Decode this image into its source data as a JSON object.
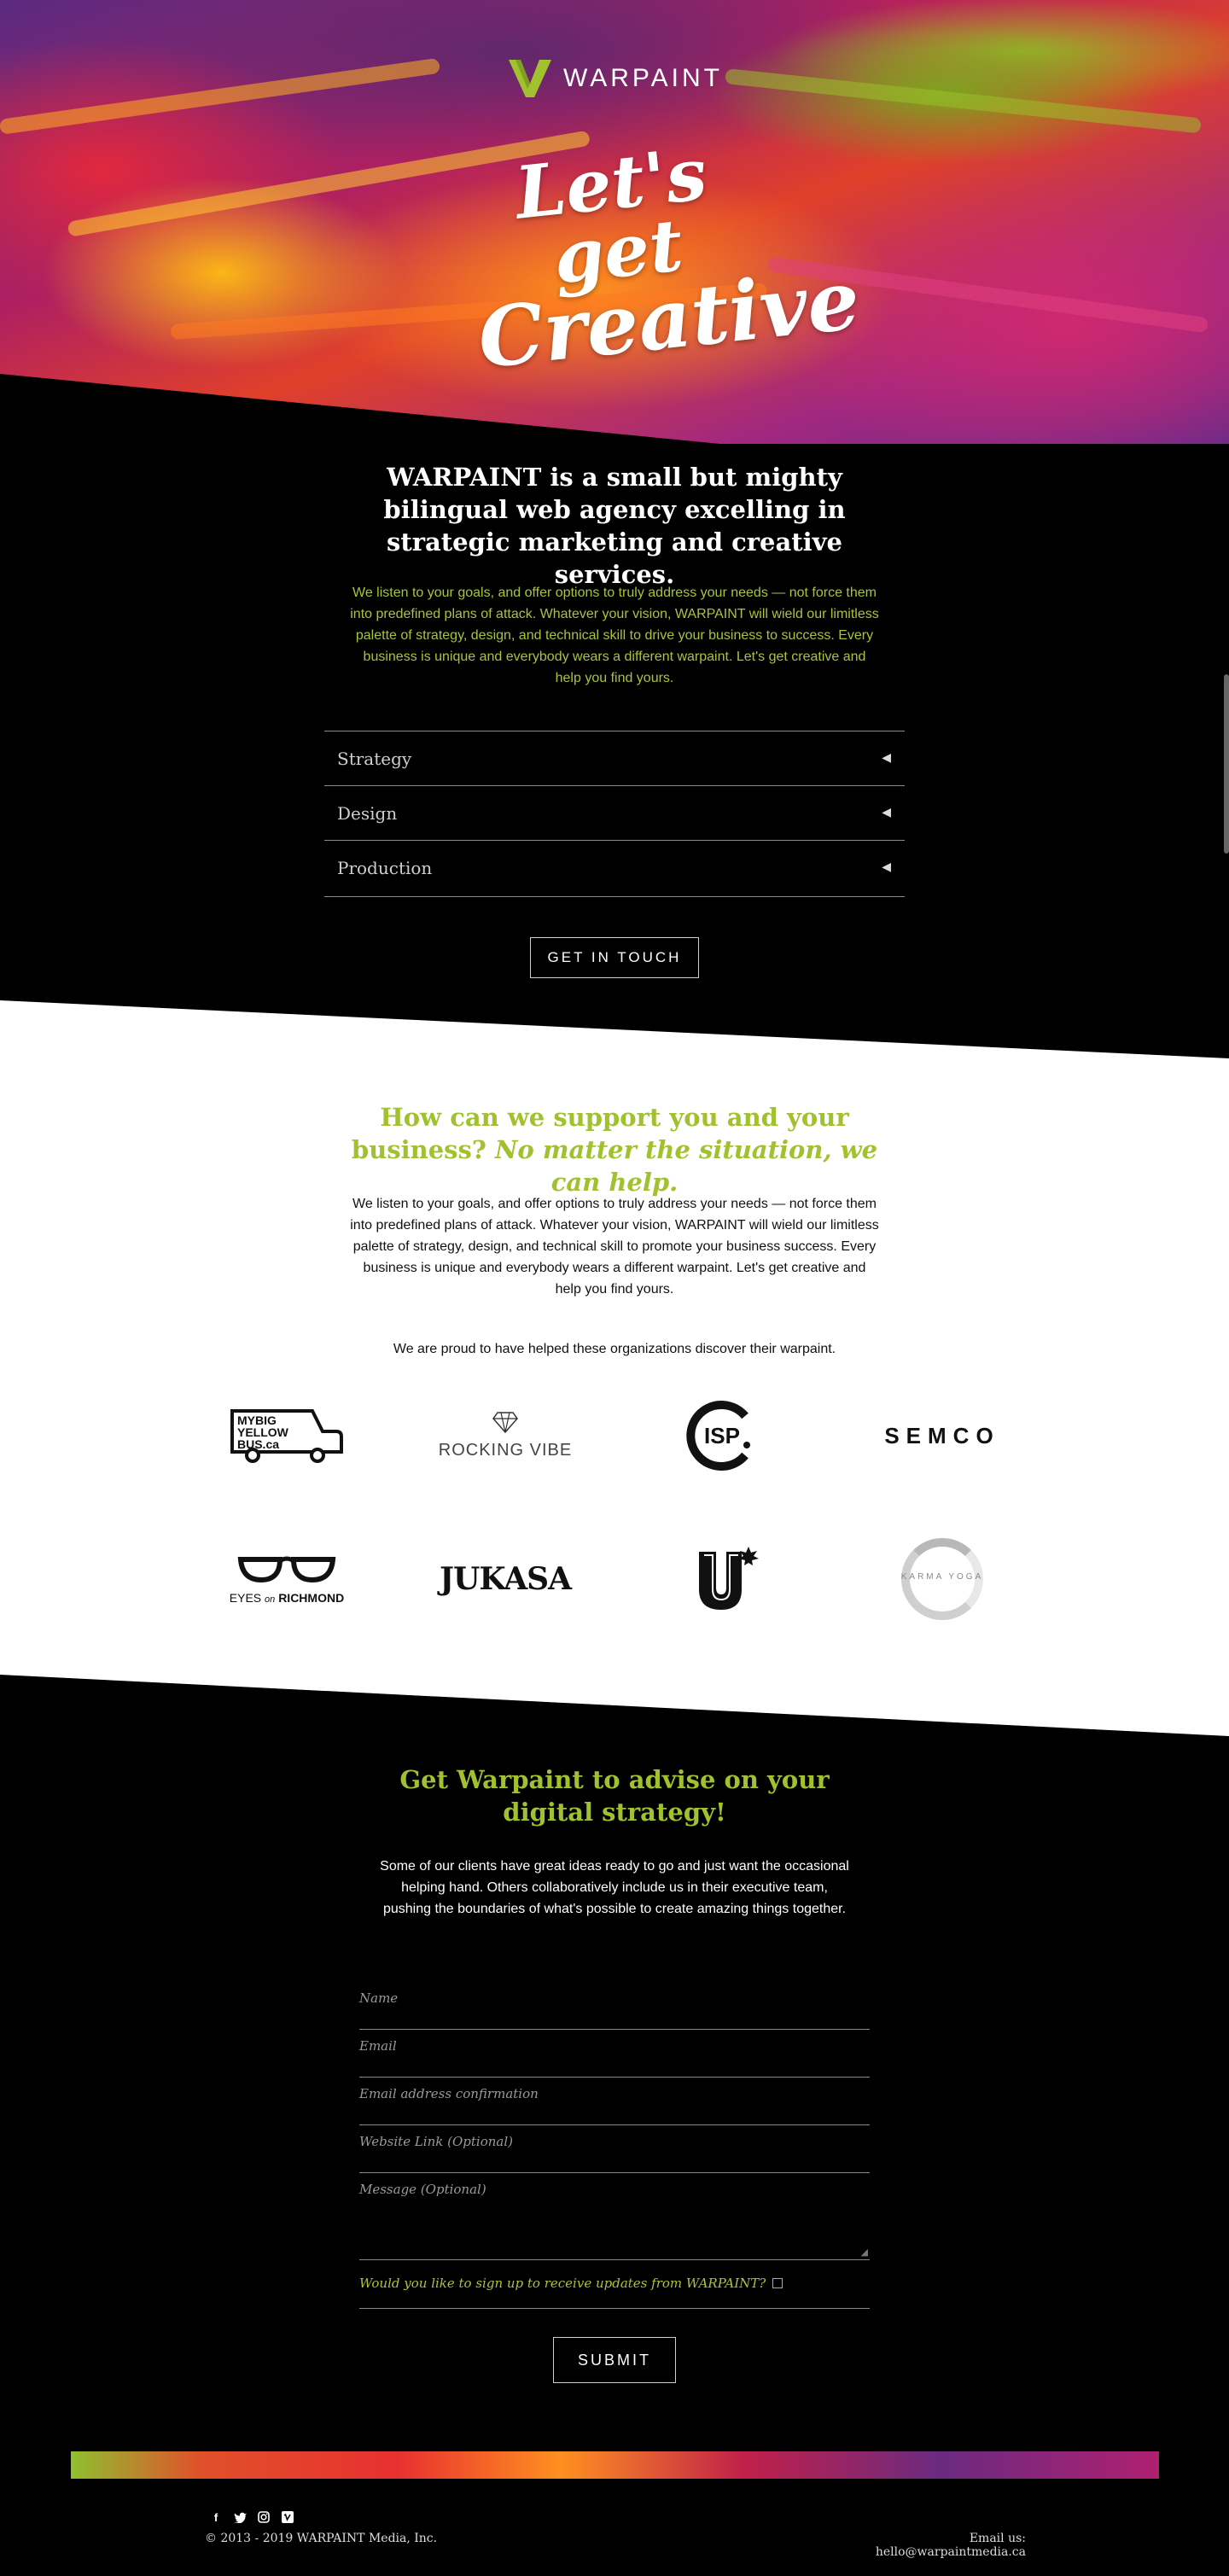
{
  "brand": {
    "name": "WARPAINT",
    "accent": "#a2c12f"
  },
  "hero": {
    "script_line1": "Let's get",
    "script_line2": "Creative"
  },
  "intro": {
    "title": "WARPAINT is a small but mighty bilingual web agency excelling in strategic marketing and creative services.",
    "body": "We listen to your goals, and offer options to truly address your needs — not force them into predefined plans of attack. Whatever your vision, WARPAINT will wield our limitless palette of strategy, design, and technical skill to drive your business to success. Every business is unique and everybody wears a different warpaint. Let's get creative and help you find yours.",
    "accordion": [
      {
        "label": "Strategy",
        "icon": "triangle-left-icon"
      },
      {
        "label": "Design",
        "icon": "triangle-left-icon"
      },
      {
        "label": "Production",
        "icon": "triangle-left-icon"
      }
    ],
    "cta": "GET IN TOUCH"
  },
  "support": {
    "title_plain": "How can we support you and your business?",
    "title_italic": "No matter the situation, we can help.",
    "body": "We listen to your goals, and offer options to truly address your needs — not force them into predefined plans of attack. Whatever your vision, WARPAINT will wield our limitless palette of strategy, design, and technical skill to promote your business success. Every business is unique and everybody wears a different warpaint. Let's get creative and help you find yours.",
    "proud": "We are proud to have helped these organizations discover their warpaint.",
    "clients": [
      {
        "name": "MYBIG YELLOW BUS.ca",
        "icon": "bus-logo"
      },
      {
        "name": "ROCKING VIBE",
        "icon": "diamond-logo"
      },
      {
        "name": "ISP",
        "icon": "isp-logo"
      },
      {
        "name": "SEMCO",
        "icon": "semco-logo"
      },
      {
        "name_a": "EYES",
        "name_b": "on",
        "name_c": "RICHMOND",
        "icon": "glasses-logo"
      },
      {
        "name": "JUKASA",
        "icon": "jukasa-logo"
      },
      {
        "name": "U",
        "icon": "u-maple-logo"
      },
      {
        "name": "KARMA YOGA",
        "icon": "karma-yoga-logo"
      }
    ]
  },
  "contact": {
    "title": "Get Warpaint to advise on your digital strategy!",
    "body": "Some of our clients have great ideas ready to go and just want the occasional helping hand. Others collaboratively include us in their executive team, pushing the boundaries of what's possible to create amazing things together.",
    "fields": {
      "name": "Name",
      "email": "Email",
      "email_confirm": "Email address confirmation",
      "website": "Website Link (Optional)",
      "message": "Message (Optional)"
    },
    "consent": "Would you like to sign up to receive updates from WARPAINT?",
    "submit": "SUBMIT"
  },
  "footer": {
    "social": [
      "facebook-icon",
      "twitter-icon",
      "instagram-icon",
      "vimeo-icon"
    ],
    "copyright": "© 2013 - 2019 WARPAINT Media, Inc.",
    "email": "Email us: hello@warpaintmedia.ca"
  }
}
